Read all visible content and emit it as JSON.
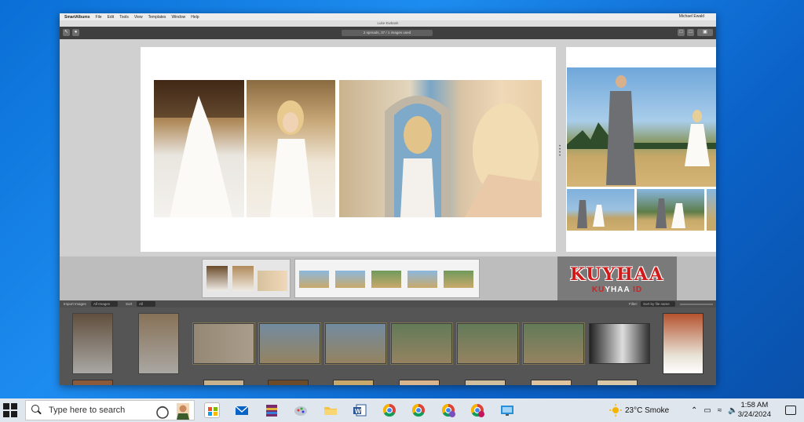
{
  "menubar": {
    "app_name": "SmartAlbums",
    "items": [
      "File",
      "Edit",
      "Tools",
      "View",
      "Templates",
      "Window",
      "Help"
    ],
    "user": "Michael Ewald"
  },
  "window": {
    "title": "Luke Ewbank"
  },
  "toolbar": {
    "status": "2 spreads, 37 / 1 images used"
  },
  "filters": {
    "images_label": "Import Images",
    "images_value": "All Images",
    "sort_label": "Sort",
    "sort_value": "All",
    "filter_label": "Filter:",
    "filter_value": "Sort by file name"
  },
  "watermark": {
    "title": "KUYHAA",
    "sub_red1": "KU",
    "sub_white": "YHAA",
    "sub_red2": " ID"
  },
  "taskbar": {
    "search_placeholder": "Type here to search",
    "weather": "23°C  Smoke",
    "time": "1:58 AM",
    "date": "3/24/2024"
  },
  "colors": {
    "desktop": "#1d8cf0",
    "taskbar": "#dfe6ee",
    "watermark_red": "#d11a1a"
  }
}
